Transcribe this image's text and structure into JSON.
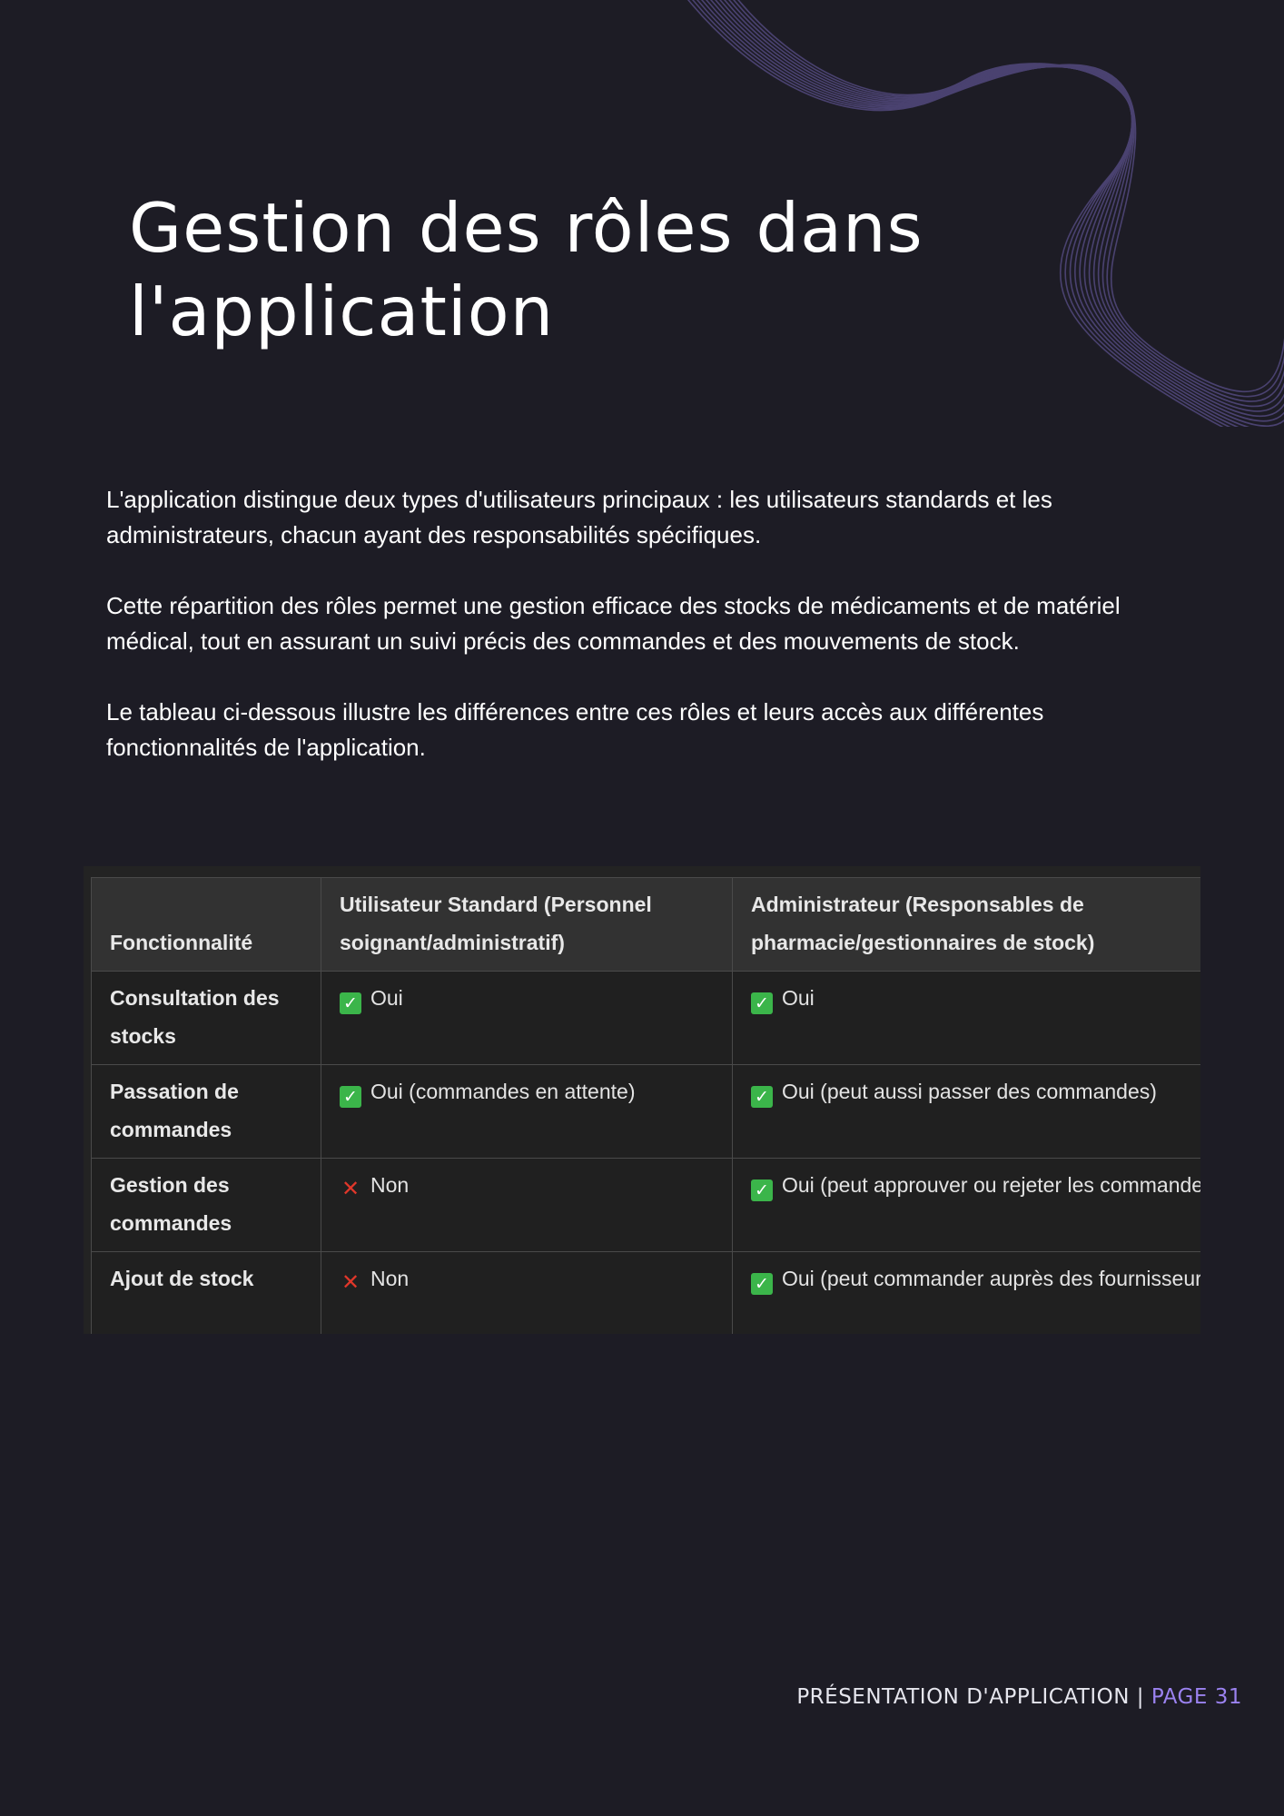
{
  "page": {
    "title": "Gestion des rôles dans l'application",
    "paragraphs": [
      "L'application distingue deux types d'utilisateurs principaux : les utilisateurs standards et les administrateurs, chacun ayant des responsabilités spécifiques.",
      "Cette répartition des rôles permet une gestion efficace des stocks de médicaments et de matériel médical, tout en assurant un suivi précis des commandes et des mouvements de stock.",
      "Le tableau ci-dessous illustre les différences entre ces rôles et leurs accès aux différentes fonctionnalités de l'application."
    ]
  },
  "table": {
    "headers": [
      "Fonctionnalité",
      "Utilisateur Standard (Personnel soignant/administratif)",
      "Administrateur (Responsables de pharmacie/gestionnaires de stock)"
    ],
    "rows": [
      {
        "feature": "Consultation des stocks",
        "standard": {
          "mark": "yes",
          "icon": "check-icon",
          "text": "Oui"
        },
        "admin": {
          "mark": "yes",
          "icon": "check-icon",
          "text": "Oui"
        }
      },
      {
        "feature": "Passation de commandes",
        "standard": {
          "mark": "yes",
          "icon": "check-icon",
          "text": "Oui (commandes en attente)"
        },
        "admin": {
          "mark": "yes",
          "icon": "check-icon",
          "text": "Oui (peut aussi passer des commandes)"
        }
      },
      {
        "feature": "Gestion des commandes",
        "standard": {
          "mark": "no",
          "icon": "cross-icon",
          "text": "Non"
        },
        "admin": {
          "mark": "yes",
          "icon": "check-icon",
          "text": "Oui (peut approuver ou rejeter les commandes)"
        }
      },
      {
        "feature": "Ajout de stock",
        "standard": {
          "mark": "no",
          "icon": "cross-icon",
          "text": "Non"
        },
        "admin": {
          "mark": "yes",
          "icon": "check-icon",
          "text": "Oui (peut commander auprès des fournisseurs)"
        }
      }
    ]
  },
  "footer": {
    "label": "PRÉSENTATION D'APPLICATION | ",
    "page": "PAGE 31"
  },
  "colors": {
    "background": "#1d1c25",
    "accent": "#9b82f0",
    "check_green": "#3bb54a",
    "cross_red": "#e0372a",
    "wave": "#4a4270"
  }
}
